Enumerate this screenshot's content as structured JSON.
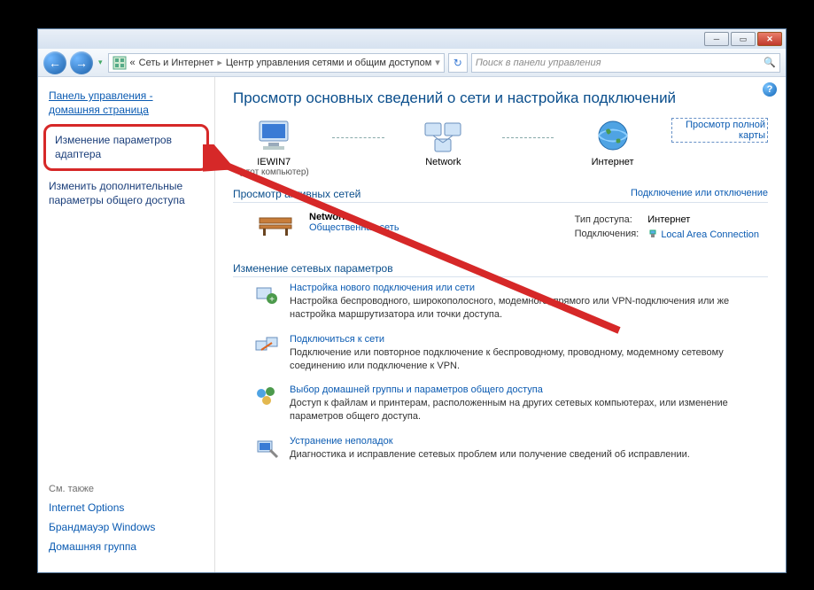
{
  "breadcrumb": {
    "prefix": "«",
    "seg1": "Сеть и Интернет",
    "seg2": "Центр управления сетями и общим доступом"
  },
  "search": {
    "placeholder": "Поиск в панели управления"
  },
  "sidebar": {
    "home": "Панель управления - домашняя страница",
    "adapter": "Изменение параметров адаптера",
    "advanced": "Изменить дополнительные параметры общего доступа",
    "seealso_hdr": "См. также",
    "seealso": {
      "internet_options": "Internet Options",
      "firewall": "Брандмауэр Windows",
      "homegroup": "Домашняя группа"
    }
  },
  "main": {
    "title": "Просмотр основных сведений о сети и настройка подключений",
    "map": {
      "full_map": "Просмотр полной карты",
      "pc_name": "IEWIN7",
      "pc_sub": "(этот компьютер)",
      "network": "Network",
      "internet": "Интернет"
    },
    "active_hdr": "Просмотр активных сетей",
    "active_right": "Подключение или отключение",
    "active": {
      "name": "Network",
      "type": "Общественная сеть",
      "access_k": "Тип доступа:",
      "access_v": "Интернет",
      "conn_k": "Подключения:",
      "conn_v": "Local Area Connection"
    },
    "change_hdr": "Изменение сетевых параметров",
    "tasks": [
      {
        "title": "Настройка нового подключения или сети",
        "desc": "Настройка беспроводного, широкополосного, модемного, прямого или VPN-подключения или же настройка маршрутизатора или точки доступа."
      },
      {
        "title": "Подключиться к сети",
        "desc": "Подключение или повторное подключение к беспроводному, проводному, модемному сетевому соединению или подключение к VPN."
      },
      {
        "title": "Выбор домашней группы и параметров общего доступа",
        "desc": "Доступ к файлам и принтерам, расположенным на других сетевых компьютерах, или изменение параметров общего доступа."
      },
      {
        "title": "Устранение неполадок",
        "desc": "Диагностика и исправление сетевых проблем или получение сведений об исправлении."
      }
    ]
  }
}
